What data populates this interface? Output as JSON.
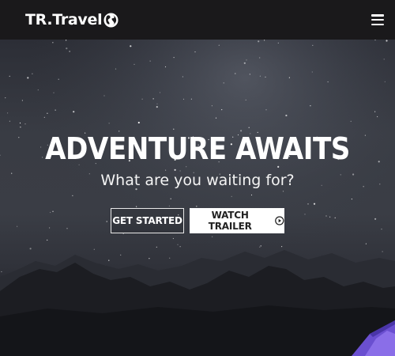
{
  "navbar": {
    "brand_text": "TR.Travel",
    "brand_icon": "globe-icon",
    "menu_icon": "hamburger-menu-icon"
  },
  "hero": {
    "title": "ADVENTURE AWAITS",
    "subtitle": "What are you waiting for?",
    "primary_button": "GET STARTED",
    "secondary_button": "WATCH TRAILER",
    "secondary_button_icon": "play-circle-icon"
  },
  "colors": {
    "navbar_bg": "#1a191b",
    "sky": "#393c44",
    "mountains": "#15161b",
    "tent_accent": "#6a4fd0"
  }
}
